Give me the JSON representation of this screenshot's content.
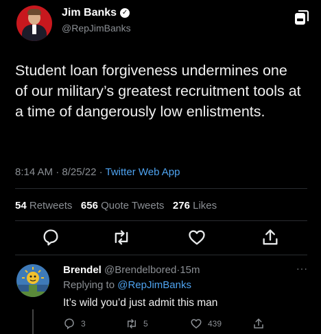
{
  "tweet": {
    "author_name": "Jim Banks",
    "author_handle": "@RepJimBanks",
    "text": "Student loan forgiveness undermines one of our military’s greatest recruitment tools at a time of dangerously low enlistments.",
    "time": "8:14 AM",
    "date": "8/25/22",
    "app": "Twitter Web App",
    "separator": "·",
    "retweets_count": "54",
    "retweets_label": "Retweets",
    "quotes_count": "656",
    "quotes_label": "Quote Tweets",
    "likes_count": "276",
    "likes_label": "Likes"
  },
  "reply": {
    "author_name": "Brendel",
    "author_handle": "@Brendelbored",
    "age": "15m",
    "replying_prefix": "Replying to",
    "replying_to": "@RepJimBanks",
    "text": "It’s wild you’d just admit this man",
    "reply_count": "3",
    "retweet_count": "5",
    "like_count": "439",
    "more_label": "···"
  },
  "icons": {
    "verified": "verified-badge-icon",
    "reply": "reply-icon",
    "retweet": "retweet-icon",
    "like": "heart-icon",
    "share": "share-icon",
    "corner": "instagram-save-icon"
  },
  "colors": {
    "background": "#000000",
    "link_blue": "#4ea3f0",
    "muted": "#8b8f94",
    "avatar_red": "#c8181e"
  }
}
